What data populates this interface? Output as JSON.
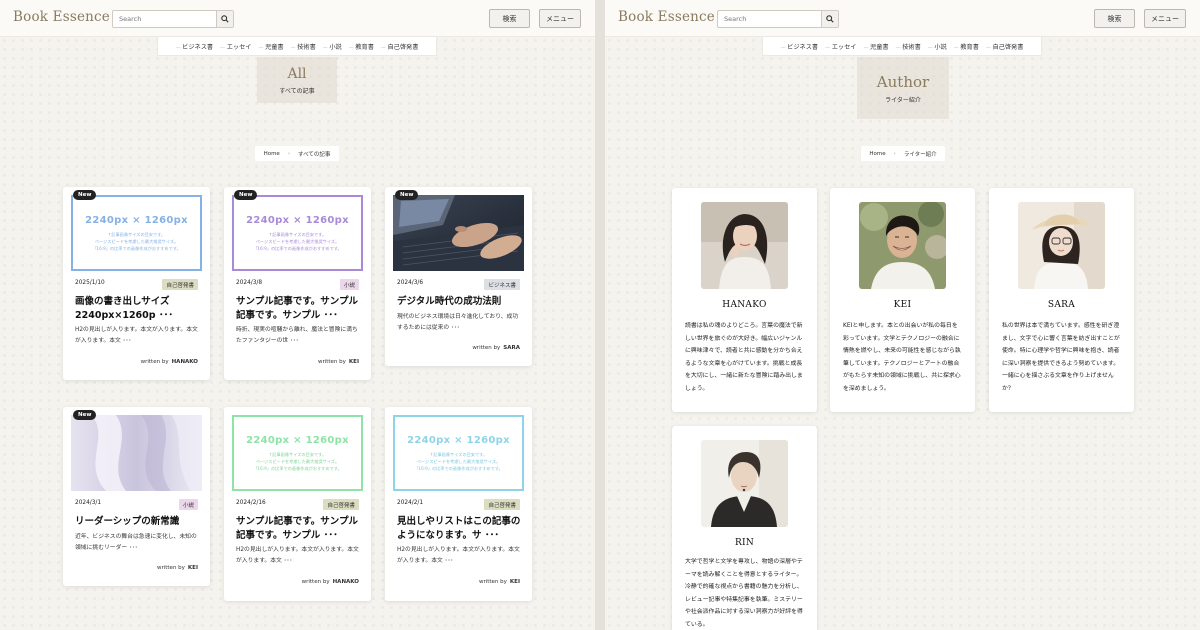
{
  "site": {
    "logo": "Book Essence",
    "search_placeholder": "Search",
    "search_button": "検索",
    "menu_button": "メニュー"
  },
  "categories": [
    "ビジネス書",
    "エッセイ",
    "児童書",
    "技術書",
    "小説",
    "教育書",
    "自己啓発書"
  ],
  "left": {
    "hero_title": "All",
    "hero_subtitle": "すべての記事",
    "breadcrumb": {
      "home": "Home",
      "current": "すべての記事"
    },
    "written_by": "written by",
    "articles": [
      {
        "new": "New",
        "thumb": "placeholder",
        "ph_color": "#86b1e4",
        "ph_title": "2240px × 1260px",
        "ph_lines": [
          "↑記事画像サイズの目安です。",
          "ページスピードを考慮した最大推奨サイズ。",
          "「16:9」の比率での画像作成がおすすめです。"
        ],
        "date": "2025/1/10",
        "tag": "自己啓発書",
        "tag_color": "#dcdcc0",
        "title": "画像の書き出しサイズ2240px×1260p ･･･",
        "excerpt": "H2の見出しが入ります。本文が入ります。本文が入ります。本文 ･･･",
        "author": "HANAKO"
      },
      {
        "new": "New",
        "thumb": "placeholder",
        "ph_color": "#a88ad8",
        "ph_title": "2240px × 1260px",
        "ph_lines": [
          "↑記事画像サイズの目安です。",
          "ページスピードを考慮した最大推奨サイズ。",
          "「16:9」の比率での画像作成がおすすめです。"
        ],
        "date": "2024/3/8",
        "tag": "小説",
        "tag_color": "#ecd6ea",
        "title": "サンプル記事です。サンプル記事です。サンプル ･･･",
        "excerpt": "時折、現実の喧騒から離れ、魔法と冒険に満ちたファンタジーの世 ･･･",
        "author": "KEI"
      },
      {
        "new": "New",
        "thumb": "laptop",
        "date": "2024/3/6",
        "tag": "ビジネス書",
        "tag_color": "#dcdfe4",
        "title": "デジタル時代の成功法則",
        "excerpt": "現代のビジネス環境は日々進化しており、成功するためには従来の ･･･",
        "author": "SARA"
      },
      {
        "new": "New",
        "thumb": "fabric",
        "date": "2024/3/1",
        "tag": "小説",
        "tag_color": "#ecd6ea",
        "title": "リーダーシップの新常識",
        "excerpt": "近年、ビジネスの舞台は急速に変化し、未知の領域に挑むリーダー ･･･",
        "author": "KEI"
      },
      {
        "new": "",
        "thumb": "placeholder",
        "ph_color": "#8ee3a6",
        "ph_title": "2240px × 1260px",
        "ph_lines": [
          "↑記事画像サイズの目安です。",
          "ページスピードを考慮した最大推奨サイズ。",
          "「16:9」の比率での画像作成がおすすめです。"
        ],
        "date": "2024/2/16",
        "tag": "自己啓発書",
        "tag_color": "#dcdcc0",
        "title": "サンプル記事です。サンプル記事です。サンプル ･･･",
        "excerpt": "H2の見出しが入ります。本文が入ります。本文が入ります。本文 ･･･",
        "author": "HANAKO"
      },
      {
        "new": "",
        "thumb": "placeholder",
        "ph_color": "#8ed4e8",
        "ph_title": "2240px × 1260px",
        "ph_lines": [
          "↑記事画像サイズの目安です。",
          "ページスピードを考慮した最大推奨サイズ。",
          "「16:9」の比率での画像作成がおすすめです。"
        ],
        "date": "2024/2/1",
        "tag": "自己啓発書",
        "tag_color": "#dcdcc0",
        "title": "見出しやリストはこの記事のようになります。サ ･･･",
        "excerpt": "H2の見出しが入ります。本文が入ります。本文が入ります。本文 ･･･",
        "author": "KEI"
      }
    ]
  },
  "right": {
    "hero_title": "Author",
    "hero_subtitle": "ライター紹介",
    "breadcrumb": {
      "home": "Home",
      "current": "ライター紹介"
    },
    "authors": [
      {
        "name": "HANAKO",
        "photo": "woman-long-hair",
        "bio": "読書は私の魂のよりどころ。言葉の魔法で新しい世界を旅ぐのが大好き。幅広いジャンルに興味津々で、読者と共に感動を分かち合えるような文章を心がけています。挑戦と成長を大切にし、一緒に新たな冒険に踏み出しましょう。"
      },
      {
        "name": "KEI",
        "photo": "man-smiling",
        "bio": "KEIと申します。本との出会いが私の毎日を彩っています。文学とテクノロジーの融合に情熱を燃やし、未来の可能性を感じながら執筆しています。テクノロジーとアートの融合がもたらす未知の領域に挑戦し、共に探求心を深めましょう。"
      },
      {
        "name": "SARA",
        "photo": "woman-hat",
        "bio": "私の世界は本で満ちています。感性を研ぎ澄まし、文字で心に響く言葉を紡ぎ出すことが使命。特に心理学や哲学に興味を抱き、読者に深い洞察を提供できるよう努めています。一緒に心を揺さぶる文章を作り上げませんか？"
      },
      {
        "name": "RIN",
        "photo": "woman-short-hair",
        "bio": "大学で哲学と文学を専攻し、物語の深層やテーマを読み解くことを得意とするライター。冷静で的確な視点から書籍の魅力を分析し、レビュー記事や特集記事を執筆。ミステリーや社会派作品に対する深い洞察力が好評を得ている。"
      }
    ]
  }
}
